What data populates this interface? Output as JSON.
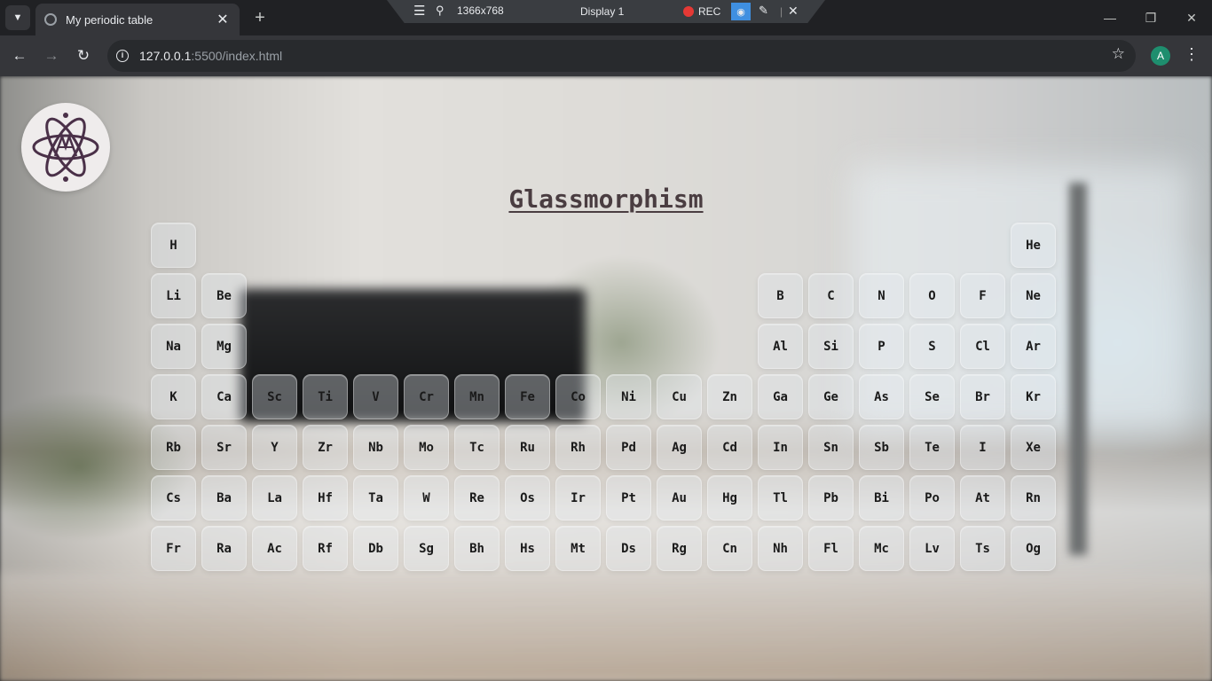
{
  "browser": {
    "tab_title": "My periodic table",
    "new_tab_label": "+",
    "url_host": "127.0.0.1",
    "url_path": ":5500/index.html",
    "profile_initial": "A"
  },
  "recorder": {
    "resolution": "1366x768",
    "display": "Display 1",
    "rec_label": "REC"
  },
  "page": {
    "title": "Glassmorphism"
  },
  "periodic_table": {
    "elements": [
      {
        "symbol": "H",
        "group": 1,
        "period": 1
      },
      {
        "symbol": "He",
        "group": 18,
        "period": 1
      },
      {
        "symbol": "Li",
        "group": 1,
        "period": 2
      },
      {
        "symbol": "Be",
        "group": 2,
        "period": 2
      },
      {
        "symbol": "B",
        "group": 13,
        "period": 2
      },
      {
        "symbol": "C",
        "group": 14,
        "period": 2
      },
      {
        "symbol": "N",
        "group": 15,
        "period": 2
      },
      {
        "symbol": "O",
        "group": 16,
        "period": 2
      },
      {
        "symbol": "F",
        "group": 17,
        "period": 2
      },
      {
        "symbol": "Ne",
        "group": 18,
        "period": 2
      },
      {
        "symbol": "Na",
        "group": 1,
        "period": 3
      },
      {
        "symbol": "Mg",
        "group": 2,
        "period": 3
      },
      {
        "symbol": "Al",
        "group": 13,
        "period": 3
      },
      {
        "symbol": "Si",
        "group": 14,
        "period": 3
      },
      {
        "symbol": "P",
        "group": 15,
        "period": 3
      },
      {
        "symbol": "S",
        "group": 16,
        "period": 3
      },
      {
        "symbol": "Cl",
        "group": 17,
        "period": 3
      },
      {
        "symbol": "Ar",
        "group": 18,
        "period": 3
      },
      {
        "symbol": "K",
        "group": 1,
        "period": 4
      },
      {
        "symbol": "Ca",
        "group": 2,
        "period": 4
      },
      {
        "symbol": "Sc",
        "group": 3,
        "period": 4
      },
      {
        "symbol": "Ti",
        "group": 4,
        "period": 4
      },
      {
        "symbol": "V",
        "group": 5,
        "period": 4
      },
      {
        "symbol": "Cr",
        "group": 6,
        "period": 4
      },
      {
        "symbol": "Mn",
        "group": 7,
        "period": 4
      },
      {
        "symbol": "Fe",
        "group": 8,
        "period": 4
      },
      {
        "symbol": "Co",
        "group": 9,
        "period": 4
      },
      {
        "symbol": "Ni",
        "group": 10,
        "period": 4
      },
      {
        "symbol": "Cu",
        "group": 11,
        "period": 4
      },
      {
        "symbol": "Zn",
        "group": 12,
        "period": 4
      },
      {
        "symbol": "Ga",
        "group": 13,
        "period": 4
      },
      {
        "symbol": "Ge",
        "group": 14,
        "period": 4
      },
      {
        "symbol": "As",
        "group": 15,
        "period": 4
      },
      {
        "symbol": "Se",
        "group": 16,
        "period": 4
      },
      {
        "symbol": "Br",
        "group": 17,
        "period": 4
      },
      {
        "symbol": "Kr",
        "group": 18,
        "period": 4
      },
      {
        "symbol": "Rb",
        "group": 1,
        "period": 5
      },
      {
        "symbol": "Sr",
        "group": 2,
        "period": 5
      },
      {
        "symbol": "Y",
        "group": 3,
        "period": 5
      },
      {
        "symbol": "Zr",
        "group": 4,
        "period": 5
      },
      {
        "symbol": "Nb",
        "group": 5,
        "period": 5
      },
      {
        "symbol": "Mo",
        "group": 6,
        "period": 5
      },
      {
        "symbol": "Tc",
        "group": 7,
        "period": 5
      },
      {
        "symbol": "Ru",
        "group": 8,
        "period": 5
      },
      {
        "symbol": "Rh",
        "group": 9,
        "period": 5
      },
      {
        "symbol": "Pd",
        "group": 10,
        "period": 5
      },
      {
        "symbol": "Ag",
        "group": 11,
        "period": 5
      },
      {
        "symbol": "Cd",
        "group": 12,
        "period": 5
      },
      {
        "symbol": "In",
        "group": 13,
        "period": 5
      },
      {
        "symbol": "Sn",
        "group": 14,
        "period": 5
      },
      {
        "symbol": "Sb",
        "group": 15,
        "period": 5
      },
      {
        "symbol": "Te",
        "group": 16,
        "period": 5
      },
      {
        "symbol": "I",
        "group": 17,
        "period": 5
      },
      {
        "symbol": "Xe",
        "group": 18,
        "period": 5
      },
      {
        "symbol": "Cs",
        "group": 1,
        "period": 6
      },
      {
        "symbol": "Ba",
        "group": 2,
        "period": 6
      },
      {
        "symbol": "La",
        "group": 3,
        "period": 6
      },
      {
        "symbol": "Hf",
        "group": 4,
        "period": 6
      },
      {
        "symbol": "Ta",
        "group": 5,
        "period": 6
      },
      {
        "symbol": "W",
        "group": 6,
        "period": 6
      },
      {
        "symbol": "Re",
        "group": 7,
        "period": 6
      },
      {
        "symbol": "Os",
        "group": 8,
        "period": 6
      },
      {
        "symbol": "Ir",
        "group": 9,
        "period": 6
      },
      {
        "symbol": "Pt",
        "group": 10,
        "period": 6
      },
      {
        "symbol": "Au",
        "group": 11,
        "period": 6
      },
      {
        "symbol": "Hg",
        "group": 12,
        "period": 6
      },
      {
        "symbol": "Tl",
        "group": 13,
        "period": 6
      },
      {
        "symbol": "Pb",
        "group": 14,
        "period": 6
      },
      {
        "symbol": "Bi",
        "group": 15,
        "period": 6
      },
      {
        "symbol": "Po",
        "group": 16,
        "period": 6
      },
      {
        "symbol": "At",
        "group": 17,
        "period": 6
      },
      {
        "symbol": "Rn",
        "group": 18,
        "period": 6
      },
      {
        "symbol": "Fr",
        "group": 1,
        "period": 7
      },
      {
        "symbol": "Ra",
        "group": 2,
        "period": 7
      },
      {
        "symbol": "Ac",
        "group": 3,
        "period": 7
      },
      {
        "symbol": "Rf",
        "group": 4,
        "period": 7
      },
      {
        "symbol": "Db",
        "group": 5,
        "period": 7
      },
      {
        "symbol": "Sg",
        "group": 6,
        "period": 7
      },
      {
        "symbol": "Bh",
        "group": 7,
        "period": 7
      },
      {
        "symbol": "Hs",
        "group": 8,
        "period": 7
      },
      {
        "symbol": "Mt",
        "group": 9,
        "period": 7
      },
      {
        "symbol": "Ds",
        "group": 10,
        "period": 7
      },
      {
        "symbol": "Rg",
        "group": 11,
        "period": 7
      },
      {
        "symbol": "Cn",
        "group": 12,
        "period": 7
      },
      {
        "symbol": "Nh",
        "group": 13,
        "period": 7
      },
      {
        "symbol": "Fl",
        "group": 14,
        "period": 7
      },
      {
        "symbol": "Mc",
        "group": 15,
        "period": 7
      },
      {
        "symbol": "Lv",
        "group": 16,
        "period": 7
      },
      {
        "symbol": "Ts",
        "group": 17,
        "period": 7
      },
      {
        "symbol": "Og",
        "group": 18,
        "period": 7
      }
    ]
  },
  "colors": {
    "title": "#4a3d41",
    "logo_bg": "#efecec",
    "logo_ink": "#4a3048",
    "chrome_dark": "#202124",
    "chrome_toolbar": "#35363a",
    "rec_dot": "#e53935",
    "profile": "#1e8e6e"
  },
  "icons": {
    "tab_menu": "chevron-down-icon",
    "favicon": "globe-icon",
    "back": "arrow-left-icon",
    "forward": "arrow-right-icon",
    "reload": "reload-icon",
    "info": "info-icon",
    "bookmark": "star-icon",
    "menu": "kebab-icon",
    "logo": "atom-icon"
  }
}
